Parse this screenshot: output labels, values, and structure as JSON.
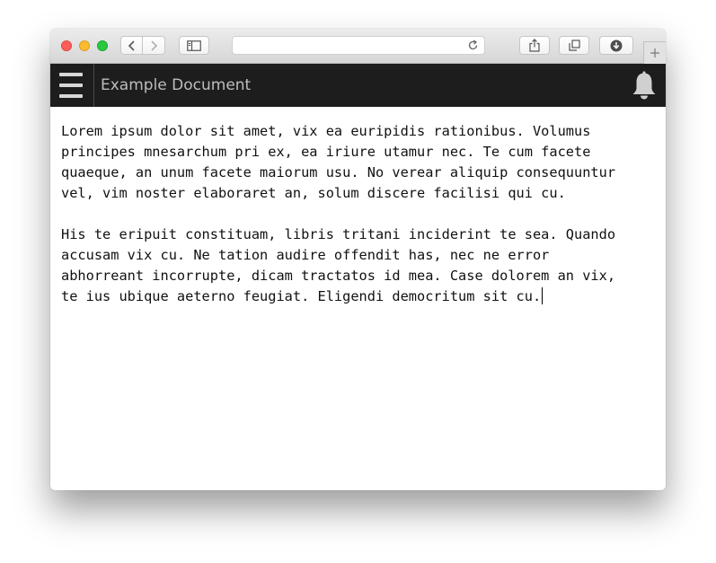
{
  "browser": {
    "address": "",
    "icons": {
      "back": "chevron-left-icon",
      "forward": "chevron-right-icon",
      "sidebar": "sidebar-icon",
      "reload": "reload-icon",
      "share": "share-icon",
      "tabs": "tabs-overview-icon",
      "download": "download-icon",
      "new_tab": "plus-icon"
    }
  },
  "app": {
    "title": "Example Document",
    "menu_icon": "hamburger-menu-icon",
    "notification_icon": "bell-icon"
  },
  "document": {
    "paragraph_1": "Lorem ipsum dolor sit amet, vix ea euripidis rationibus. Volumus\nprincipes mnesarchum pri ex, ea iriure utamur nec. Te cum facete\nquaeque, an unum facete maiorum usu. No verear aliquip consequuntur\nvel, vim noster elaboraret an, solum discere facilisi qui cu.",
    "paragraph_2": "His te eripuit constituam, libris tritani inciderint te sea. Quando\naccusam vix cu. Ne tation audire offendit has, nec ne error\nabhorreant incorrupte, dicam tractatos id mea. Case dolorem an vix,\nte ius ubique aeterno feugiat. Eligendi democritum sit cu."
  },
  "colors": {
    "appbar_background": "#1d1d1d",
    "title_text": "#bdbdbd",
    "close": "#fc5f57",
    "minimize": "#fdbc2e",
    "zoom": "#28c840"
  }
}
